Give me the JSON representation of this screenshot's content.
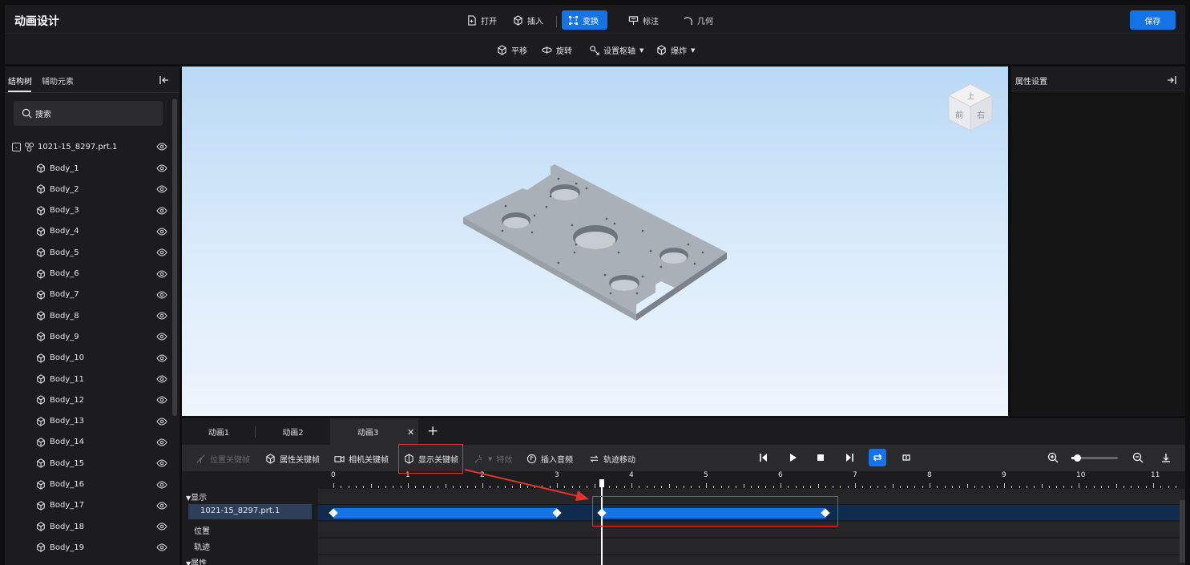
{
  "app": {
    "title": "动画设计",
    "save_label": "保存"
  },
  "menu": [
    {
      "label": "打开",
      "icon": "open-file-icon"
    },
    {
      "label": "插入",
      "icon": "cube-icon"
    },
    {
      "label": "变换",
      "icon": "transform-icon",
      "active": true
    },
    {
      "label": "标注",
      "icon": "annotation-icon"
    },
    {
      "label": "几何",
      "icon": "geometry-icon"
    }
  ],
  "subtoolbar": [
    {
      "label": "平移",
      "icon": "translate-icon"
    },
    {
      "label": "旋转",
      "icon": "rotate-icon"
    },
    {
      "label": "设置枢轴",
      "icon": "pivot-icon",
      "dropdown": true
    },
    {
      "label": "爆炸",
      "icon": "explode-icon",
      "dropdown": true
    }
  ],
  "left_panel": {
    "tabs": [
      "结构树",
      "辅助元素"
    ],
    "active_tab": 0,
    "search_placeholder": "搜索",
    "root": {
      "label": "1021-15_8297.prt.1"
    },
    "items": [
      "Body_1",
      "Body_2",
      "Body_3",
      "Body_4",
      "Body_5",
      "Body_6",
      "Body_7",
      "Body_8",
      "Body_9",
      "Body_10",
      "Body_11",
      "Body_12",
      "Body_13",
      "Body_14",
      "Body_15",
      "Body_16",
      "Body_17",
      "Body_18",
      "Body_19"
    ]
  },
  "right_panel": {
    "title": "属性设置"
  },
  "view_cube": {
    "top": "上",
    "front": "前",
    "right": "右"
  },
  "timeline": {
    "tabs": [
      "动画1",
      "动画2",
      "动画3"
    ],
    "active_tab": 2,
    "toolbar": [
      {
        "label": "位置关键帧",
        "disabled": true
      },
      {
        "label": "属性关键帧",
        "disabled": false
      },
      {
        "label": "相机关键帧",
        "disabled": false
      },
      {
        "label": "显示关键帧",
        "disabled": false
      },
      {
        "label": "特效",
        "disabled": true
      },
      {
        "label": "插入音频",
        "disabled": false
      },
      {
        "label": "轨迹移动",
        "disabled": false
      }
    ],
    "ruler_ticks": [
      "0",
      "1",
      "2",
      "3",
      "4",
      "5",
      "6",
      "7",
      "8",
      "9",
      "10",
      "11"
    ],
    "labels": {
      "group_display": "显示",
      "track_name": "1021-15_8297.prt.1",
      "position": "位置",
      "trajectory": "轨迹",
      "group_attrs": "属性"
    },
    "playhead_time": 3.6,
    "zoom_level": 0.12,
    "segments": [
      {
        "start": 0,
        "end": 3
      },
      {
        "start": 3.6,
        "end": 6.6
      }
    ]
  },
  "colors": {
    "accent": "#1473e6",
    "highlight": "#e5322d"
  }
}
